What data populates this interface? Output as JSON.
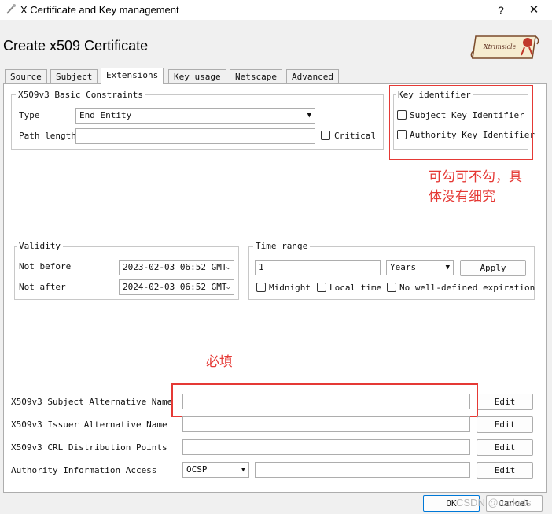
{
  "window": {
    "title": "X Certificate and Key management",
    "help_label": "?",
    "close_label": "✕"
  },
  "page_title": "Create x509 Certificate",
  "logo_text": "Xtrimsicle",
  "tabs": [
    "Source",
    "Subject",
    "Extensions",
    "Key usage",
    "Netscape",
    "Advanced"
  ],
  "basic_constraints": {
    "legend": "X509v3 Basic Constraints",
    "type_label": "Type",
    "type_value": "End Entity",
    "path_length_label": "Path length",
    "path_length_value": "",
    "critical_label": "Critical"
  },
  "key_identifier": {
    "legend": "Key identifier",
    "subject_label": "Subject Key Identifier",
    "authority_label": "Authority Key Identifier"
  },
  "validity": {
    "legend": "Validity",
    "not_before_label": "Not before",
    "not_before_value": "2023-02-03 06:52 GMT",
    "not_after_label": "Not after",
    "not_after_value": "2024-02-03 06:52 GMT"
  },
  "time_range": {
    "legend": "Time range",
    "amount": "1",
    "unit": "Years",
    "apply_label": "Apply",
    "midnight_label": "Midnight",
    "local_time_label": "Local time",
    "no_expiration_label": "No well-defined expiration"
  },
  "alt_names": [
    {
      "label": "X509v3 Subject Alternative Name",
      "value": "",
      "button": "Edit"
    },
    {
      "label": "X509v3 Issuer Alternative Name",
      "value": "",
      "button": "Edit"
    },
    {
      "label": "X509v3 CRL Distribution Points",
      "value": "",
      "button": "Edit"
    },
    {
      "label": "Authority Information Access",
      "value": "",
      "button": "Edit",
      "method": "OCSP"
    }
  ],
  "annotations": {
    "optional_note_line1": "可勾可不勾，具",
    "optional_note_line2": "体没有细究",
    "required_note": "必填"
  },
  "footer": {
    "ok_label": "OK",
    "cancel_label": "Cancel"
  },
  "watermark": "CSDN @rockets",
  "colors": {
    "annotation_red": "#e53935",
    "focus_blue": "#0078d7"
  }
}
